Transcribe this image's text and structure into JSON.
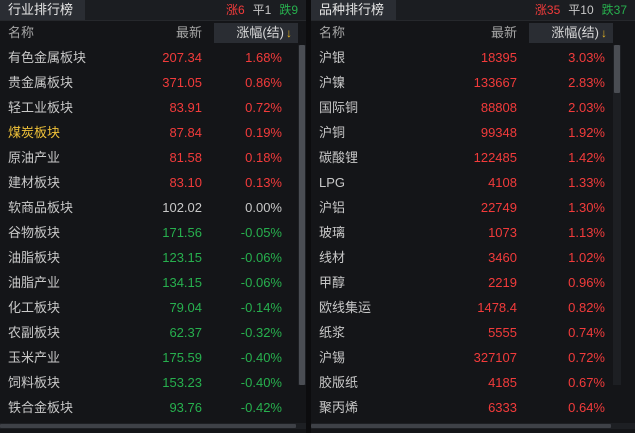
{
  "left": {
    "title": "行业排行榜",
    "counts": {
      "up": "涨6",
      "flat": "平1",
      "down": "跌9"
    },
    "columns": {
      "name": "名称",
      "last": "最新",
      "change": "涨幅(结)"
    },
    "rows": [
      {
        "name": "有色金属板块",
        "last": "207.34",
        "change": "1.68%",
        "dir": "up"
      },
      {
        "name": "贵金属板块",
        "last": "371.05",
        "change": "0.86%",
        "dir": "up"
      },
      {
        "name": "轻工业板块",
        "last": "83.91",
        "change": "0.72%",
        "dir": "up"
      },
      {
        "name": "煤炭板块",
        "last": "87.84",
        "change": "0.19%",
        "dir": "up",
        "highlight": true
      },
      {
        "name": "原油产业",
        "last": "81.58",
        "change": "0.18%",
        "dir": "up"
      },
      {
        "name": "建材板块",
        "last": "83.10",
        "change": "0.13%",
        "dir": "up"
      },
      {
        "name": "软商品板块",
        "last": "102.02",
        "change": "0.00%",
        "dir": "flat"
      },
      {
        "name": "谷物板块",
        "last": "171.56",
        "change": "-0.05%",
        "dir": "down"
      },
      {
        "name": "油脂板块",
        "last": "123.15",
        "change": "-0.06%",
        "dir": "down"
      },
      {
        "name": "油脂产业",
        "last": "134.15",
        "change": "-0.06%",
        "dir": "down"
      },
      {
        "name": "化工板块",
        "last": "79.04",
        "change": "-0.14%",
        "dir": "down"
      },
      {
        "name": "农副板块",
        "last": "62.37",
        "change": "-0.32%",
        "dir": "down"
      },
      {
        "name": "玉米产业",
        "last": "175.59",
        "change": "-0.40%",
        "dir": "down"
      },
      {
        "name": "饲料板块",
        "last": "153.23",
        "change": "-0.40%",
        "dir": "down"
      },
      {
        "name": "铁合金板块",
        "last": "93.76",
        "change": "-0.42%",
        "dir": "down"
      }
    ]
  },
  "right": {
    "title": "品种排行榜",
    "counts": {
      "up": "涨35",
      "flat": "平10",
      "down": "跌37"
    },
    "columns": {
      "name": "名称",
      "last": "最新",
      "change": "涨幅(结)"
    },
    "rows": [
      {
        "name": "沪银",
        "last": "18395",
        "change": "3.03%",
        "dir": "up"
      },
      {
        "name": "沪镍",
        "last": "133667",
        "change": "2.83%",
        "dir": "up"
      },
      {
        "name": "国际铜",
        "last": "88808",
        "change": "2.03%",
        "dir": "up"
      },
      {
        "name": "沪铜",
        "last": "99348",
        "change": "1.92%",
        "dir": "up"
      },
      {
        "name": "碳酸锂",
        "last": "122485",
        "change": "1.42%",
        "dir": "up"
      },
      {
        "name": "LPG",
        "last": "4108",
        "change": "1.33%",
        "dir": "up"
      },
      {
        "name": "沪铝",
        "last": "22749",
        "change": "1.30%",
        "dir": "up"
      },
      {
        "name": "玻璃",
        "last": "1073",
        "change": "1.13%",
        "dir": "up"
      },
      {
        "name": "线材",
        "last": "3460",
        "change": "1.02%",
        "dir": "up"
      },
      {
        "name": "甲醇",
        "last": "2219",
        "change": "0.96%",
        "dir": "up"
      },
      {
        "name": "欧线集运",
        "last": "1478.4",
        "change": "0.82%",
        "dir": "up"
      },
      {
        "name": "纸浆",
        "last": "5555",
        "change": "0.74%",
        "dir": "up"
      },
      {
        "name": "沪锡",
        "last": "327107",
        "change": "0.72%",
        "dir": "up"
      },
      {
        "name": "胶版纸",
        "last": "4185",
        "change": "0.67%",
        "dir": "up"
      },
      {
        "name": "聚丙烯",
        "last": "6333",
        "change": "0.64%",
        "dir": "up"
      }
    ]
  },
  "colors": {
    "up": "#f23b3b",
    "flat": "#c8c8c8",
    "down": "#27b04e",
    "highlight": "#f0c239"
  },
  "icons": {
    "sort": "sort-down-arrow-icon"
  }
}
